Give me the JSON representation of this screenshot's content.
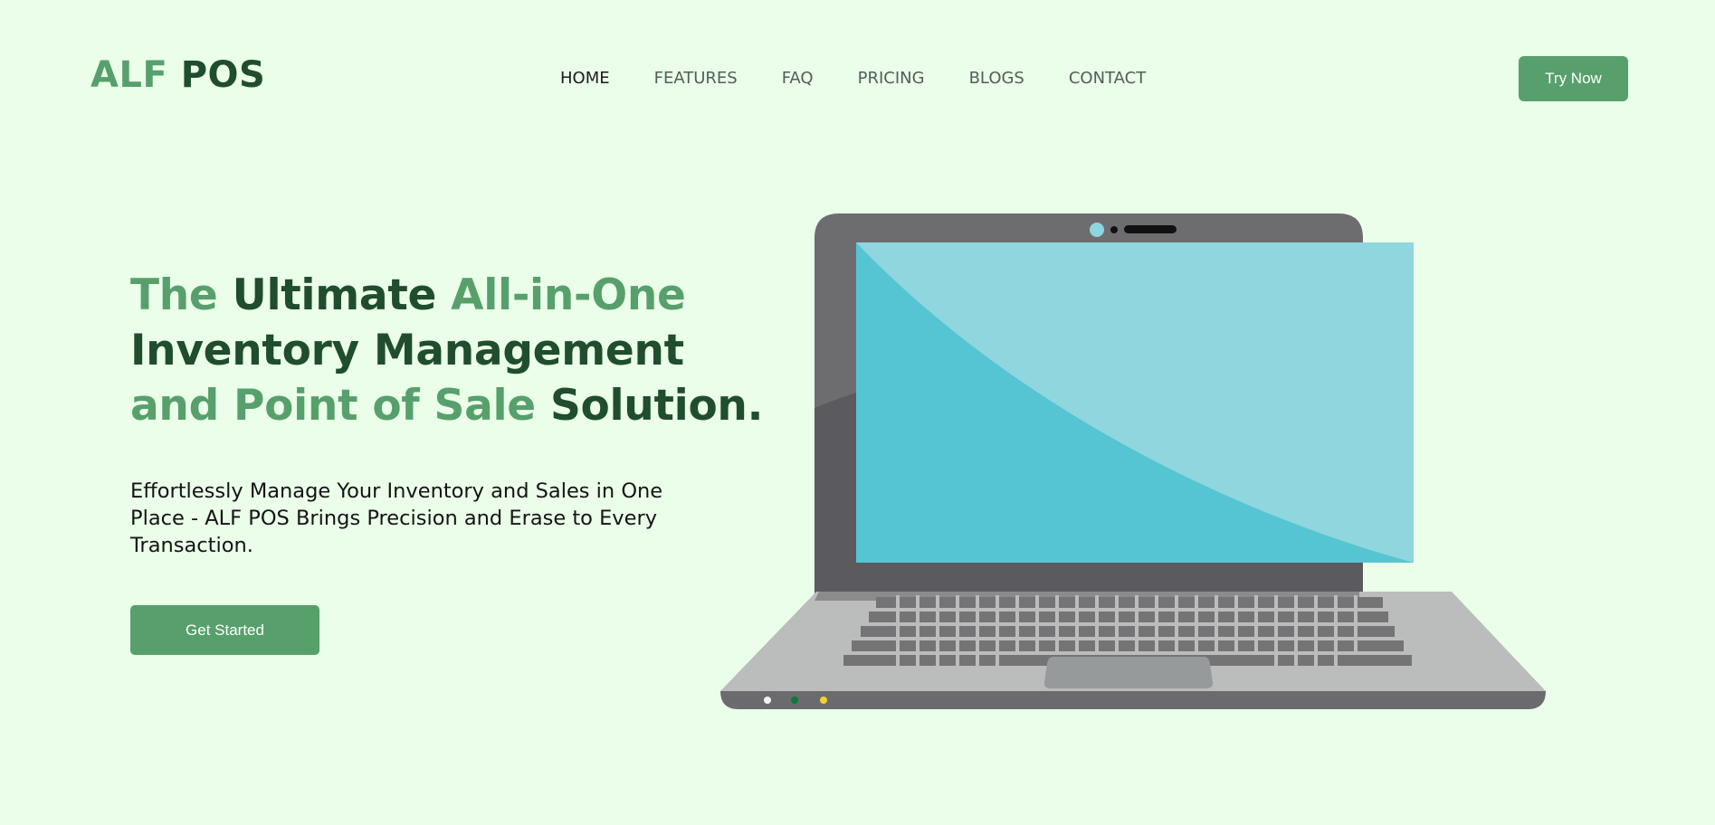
{
  "brand": {
    "part1": "ALF",
    "part2": "POS"
  },
  "nav": {
    "items": [
      {
        "label": "HOME"
      },
      {
        "label": "FEATURES"
      },
      {
        "label": "FAQ"
      },
      {
        "label": "PRICING"
      },
      {
        "label": "BLOGS"
      },
      {
        "label": "CONTACT"
      }
    ],
    "active": "HOME"
  },
  "header": {
    "cta_label": "Try Now"
  },
  "hero": {
    "title": {
      "w1": "The",
      "w2": "Ultimate",
      "w3": "All-in-One",
      "w4": "Inventory Management",
      "w5": "and Point of Sale",
      "w6": "Solution."
    },
    "subtitle": "Effortlessly Manage Your Inventory and Sales in One Place - ALF POS Brings Precision and Erase to Every Transaction.",
    "cta_label": "Get Started"
  },
  "colors": {
    "background": "#eafee9",
    "brand_light": "#57a06b",
    "brand_dark": "#1f4d2d",
    "button": "#57a06b",
    "screen": "#55c5d3"
  },
  "illustration": {
    "icon": "laptop-illustration"
  }
}
